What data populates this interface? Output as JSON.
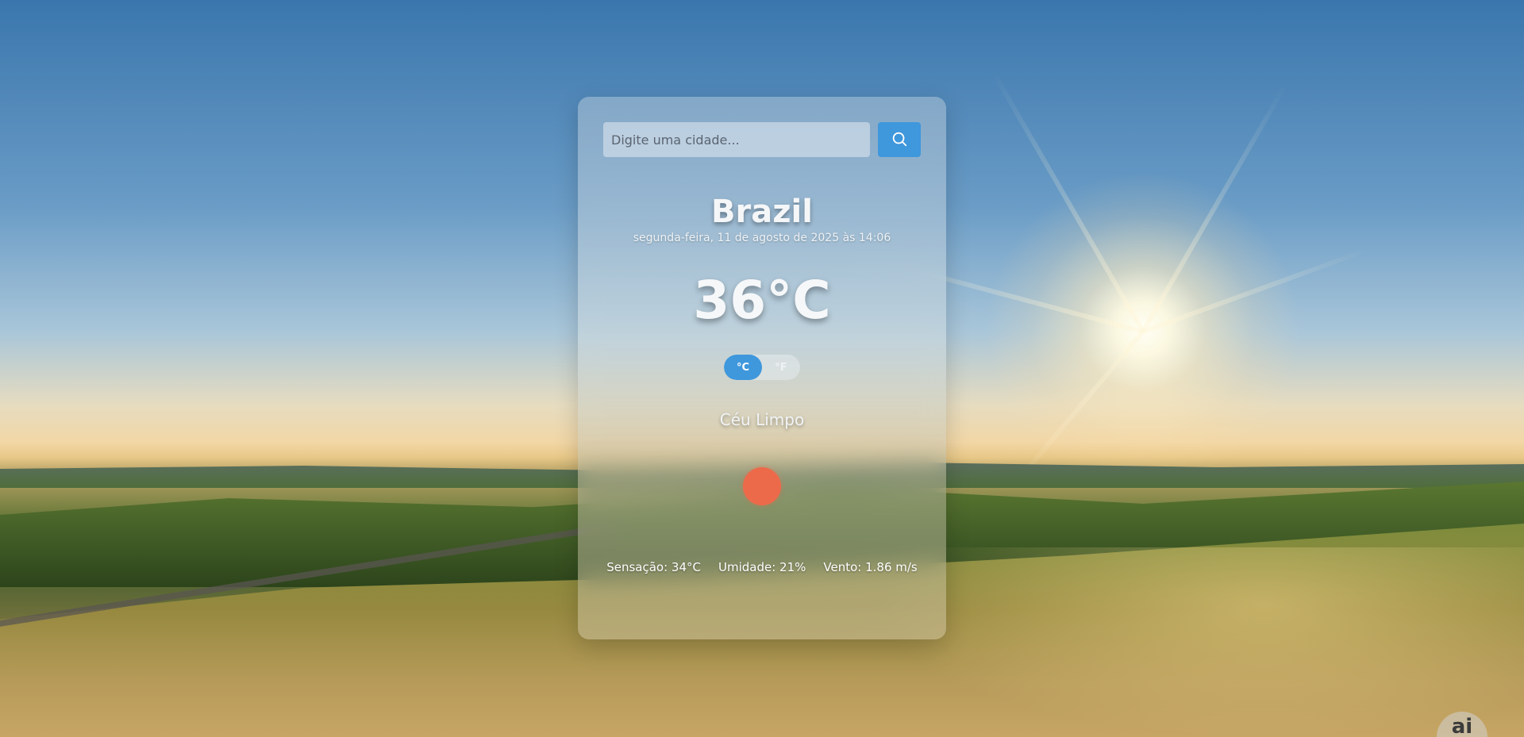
{
  "search": {
    "placeholder": "Digite uma cidade...",
    "value": "",
    "button_icon": "search-icon"
  },
  "location": {
    "city": "Brazil",
    "datetime": "segunda-feira, 11 de agosto de 2025 às 14:06"
  },
  "current": {
    "temperature": "36°C",
    "description": "Céu Limpo",
    "icon": "clear-sky-sun-icon",
    "icon_color": "#ec6a4a"
  },
  "units": {
    "celsius_label": "°C",
    "fahrenheit_label": "°F",
    "selected": "°C"
  },
  "details": {
    "feels_like": "Sensação: 34°C",
    "humidity": "Umidade: 21%",
    "wind": "Vento: 1.86 m/s"
  },
  "badge": {
    "label": "ai"
  },
  "colors": {
    "accent": "#3f97dc"
  }
}
